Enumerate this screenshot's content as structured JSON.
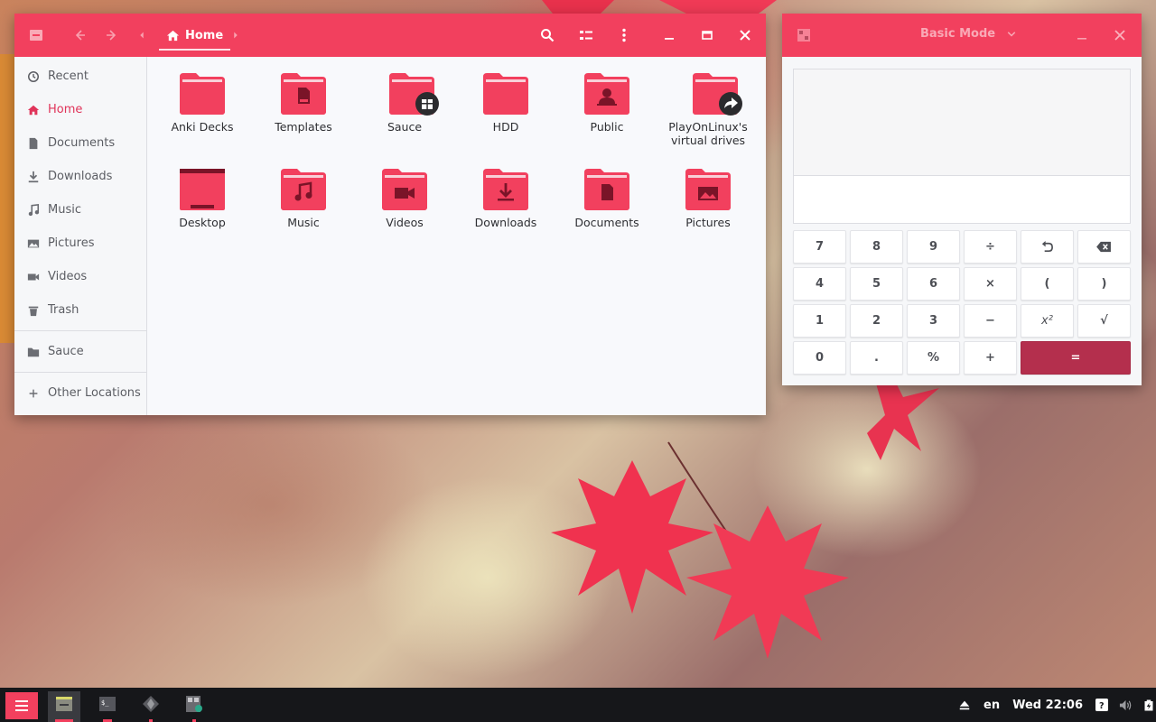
{
  "files": {
    "title": "Home",
    "sidebar": [
      {
        "label": "Recent",
        "icon": "clock-icon"
      },
      {
        "label": "Home",
        "icon": "home-icon"
      },
      {
        "label": "Documents",
        "icon": "document-icon"
      },
      {
        "label": "Downloads",
        "icon": "download-icon"
      },
      {
        "label": "Music",
        "icon": "music-icon"
      },
      {
        "label": "Pictures",
        "icon": "image-icon"
      },
      {
        "label": "Videos",
        "icon": "video-icon"
      },
      {
        "label": "Trash",
        "icon": "trash-icon"
      },
      {
        "label": "Sauce",
        "icon": "folder-icon"
      },
      {
        "label": "Other Locations",
        "icon": "plus-icon"
      }
    ],
    "folders": [
      {
        "label": "Anki Decks"
      },
      {
        "label": "Templates"
      },
      {
        "label": "Sauce"
      },
      {
        "label": "HDD"
      },
      {
        "label": "Public"
      },
      {
        "label": "PlayOnLinux's virtual drives"
      },
      {
        "label": "Desktop"
      },
      {
        "label": "Music"
      },
      {
        "label": "Videos"
      },
      {
        "label": "Downloads"
      },
      {
        "label": "Documents"
      },
      {
        "label": "Pictures"
      }
    ]
  },
  "calculator": {
    "mode": "Basic Mode",
    "keys": [
      [
        "7",
        "8",
        "9",
        "÷",
        "↶",
        "⌫"
      ],
      [
        "4",
        "5",
        "6",
        "×",
        "(",
        ")"
      ],
      [
        "1",
        "2",
        "3",
        "−",
        "x²",
        "√"
      ],
      [
        "0",
        ".",
        "%",
        "+",
        "="
      ]
    ]
  },
  "taskbar": {
    "language": "en",
    "clock": "Wed 22:06"
  },
  "colors": {
    "accent": "#f2405e",
    "equals": "#b42f4d",
    "taskbar": "#16171a"
  }
}
